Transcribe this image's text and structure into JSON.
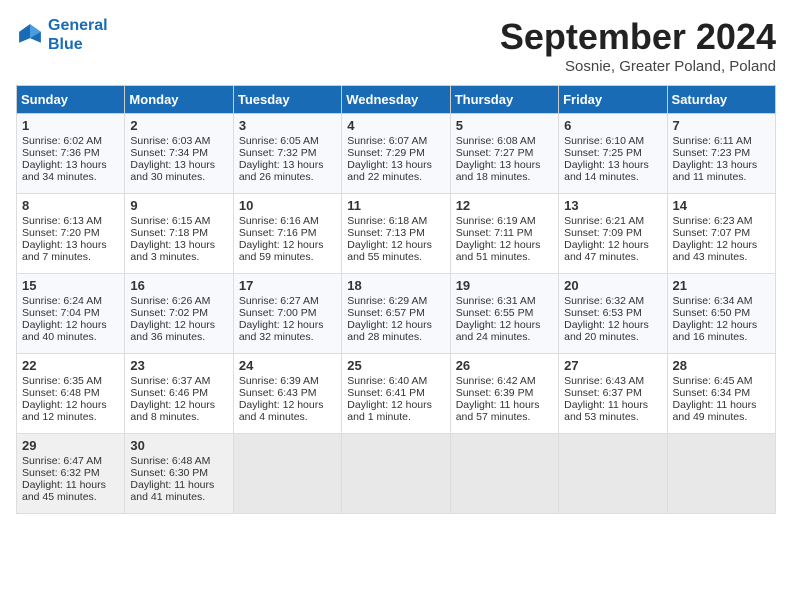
{
  "header": {
    "logo_line1": "General",
    "logo_line2": "Blue",
    "month": "September 2024",
    "location": "Sosnie, Greater Poland, Poland"
  },
  "weekdays": [
    "Sunday",
    "Monday",
    "Tuesday",
    "Wednesday",
    "Thursday",
    "Friday",
    "Saturday"
  ],
  "weeks": [
    [
      {
        "day": "1",
        "lines": [
          "Sunrise: 6:02 AM",
          "Sunset: 7:36 PM",
          "Daylight: 13 hours",
          "and 34 minutes."
        ]
      },
      {
        "day": "2",
        "lines": [
          "Sunrise: 6:03 AM",
          "Sunset: 7:34 PM",
          "Daylight: 13 hours",
          "and 30 minutes."
        ]
      },
      {
        "day": "3",
        "lines": [
          "Sunrise: 6:05 AM",
          "Sunset: 7:32 PM",
          "Daylight: 13 hours",
          "and 26 minutes."
        ]
      },
      {
        "day": "4",
        "lines": [
          "Sunrise: 6:07 AM",
          "Sunset: 7:29 PM",
          "Daylight: 13 hours",
          "and 22 minutes."
        ]
      },
      {
        "day": "5",
        "lines": [
          "Sunrise: 6:08 AM",
          "Sunset: 7:27 PM",
          "Daylight: 13 hours",
          "and 18 minutes."
        ]
      },
      {
        "day": "6",
        "lines": [
          "Sunrise: 6:10 AM",
          "Sunset: 7:25 PM",
          "Daylight: 13 hours",
          "and 14 minutes."
        ]
      },
      {
        "day": "7",
        "lines": [
          "Sunrise: 6:11 AM",
          "Sunset: 7:23 PM",
          "Daylight: 13 hours",
          "and 11 minutes."
        ]
      }
    ],
    [
      {
        "day": "8",
        "lines": [
          "Sunrise: 6:13 AM",
          "Sunset: 7:20 PM",
          "Daylight: 13 hours",
          "and 7 minutes."
        ]
      },
      {
        "day": "9",
        "lines": [
          "Sunrise: 6:15 AM",
          "Sunset: 7:18 PM",
          "Daylight: 13 hours",
          "and 3 minutes."
        ]
      },
      {
        "day": "10",
        "lines": [
          "Sunrise: 6:16 AM",
          "Sunset: 7:16 PM",
          "Daylight: 12 hours",
          "and 59 minutes."
        ]
      },
      {
        "day": "11",
        "lines": [
          "Sunrise: 6:18 AM",
          "Sunset: 7:13 PM",
          "Daylight: 12 hours",
          "and 55 minutes."
        ]
      },
      {
        "day": "12",
        "lines": [
          "Sunrise: 6:19 AM",
          "Sunset: 7:11 PM",
          "Daylight: 12 hours",
          "and 51 minutes."
        ]
      },
      {
        "day": "13",
        "lines": [
          "Sunrise: 6:21 AM",
          "Sunset: 7:09 PM",
          "Daylight: 12 hours",
          "and 47 minutes."
        ]
      },
      {
        "day": "14",
        "lines": [
          "Sunrise: 6:23 AM",
          "Sunset: 7:07 PM",
          "Daylight: 12 hours",
          "and 43 minutes."
        ]
      }
    ],
    [
      {
        "day": "15",
        "lines": [
          "Sunrise: 6:24 AM",
          "Sunset: 7:04 PM",
          "Daylight: 12 hours",
          "and 40 minutes."
        ]
      },
      {
        "day": "16",
        "lines": [
          "Sunrise: 6:26 AM",
          "Sunset: 7:02 PM",
          "Daylight: 12 hours",
          "and 36 minutes."
        ]
      },
      {
        "day": "17",
        "lines": [
          "Sunrise: 6:27 AM",
          "Sunset: 7:00 PM",
          "Daylight: 12 hours",
          "and 32 minutes."
        ]
      },
      {
        "day": "18",
        "lines": [
          "Sunrise: 6:29 AM",
          "Sunset: 6:57 PM",
          "Daylight: 12 hours",
          "and 28 minutes."
        ]
      },
      {
        "day": "19",
        "lines": [
          "Sunrise: 6:31 AM",
          "Sunset: 6:55 PM",
          "Daylight: 12 hours",
          "and 24 minutes."
        ]
      },
      {
        "day": "20",
        "lines": [
          "Sunrise: 6:32 AM",
          "Sunset: 6:53 PM",
          "Daylight: 12 hours",
          "and 20 minutes."
        ]
      },
      {
        "day": "21",
        "lines": [
          "Sunrise: 6:34 AM",
          "Sunset: 6:50 PM",
          "Daylight: 12 hours",
          "and 16 minutes."
        ]
      }
    ],
    [
      {
        "day": "22",
        "lines": [
          "Sunrise: 6:35 AM",
          "Sunset: 6:48 PM",
          "Daylight: 12 hours",
          "and 12 minutes."
        ]
      },
      {
        "day": "23",
        "lines": [
          "Sunrise: 6:37 AM",
          "Sunset: 6:46 PM",
          "Daylight: 12 hours",
          "and 8 minutes."
        ]
      },
      {
        "day": "24",
        "lines": [
          "Sunrise: 6:39 AM",
          "Sunset: 6:43 PM",
          "Daylight: 12 hours",
          "and 4 minutes."
        ]
      },
      {
        "day": "25",
        "lines": [
          "Sunrise: 6:40 AM",
          "Sunset: 6:41 PM",
          "Daylight: 12 hours",
          "and 1 minute."
        ]
      },
      {
        "day": "26",
        "lines": [
          "Sunrise: 6:42 AM",
          "Sunset: 6:39 PM",
          "Daylight: 11 hours",
          "and 57 minutes."
        ]
      },
      {
        "day": "27",
        "lines": [
          "Sunrise: 6:43 AM",
          "Sunset: 6:37 PM",
          "Daylight: 11 hours",
          "and 53 minutes."
        ]
      },
      {
        "day": "28",
        "lines": [
          "Sunrise: 6:45 AM",
          "Sunset: 6:34 PM",
          "Daylight: 11 hours",
          "and 49 minutes."
        ]
      }
    ],
    [
      {
        "day": "29",
        "lines": [
          "Sunrise: 6:47 AM",
          "Sunset: 6:32 PM",
          "Daylight: 11 hours",
          "and 45 minutes."
        ]
      },
      {
        "day": "30",
        "lines": [
          "Sunrise: 6:48 AM",
          "Sunset: 6:30 PM",
          "Daylight: 11 hours",
          "and 41 minutes."
        ]
      },
      null,
      null,
      null,
      null,
      null
    ]
  ]
}
